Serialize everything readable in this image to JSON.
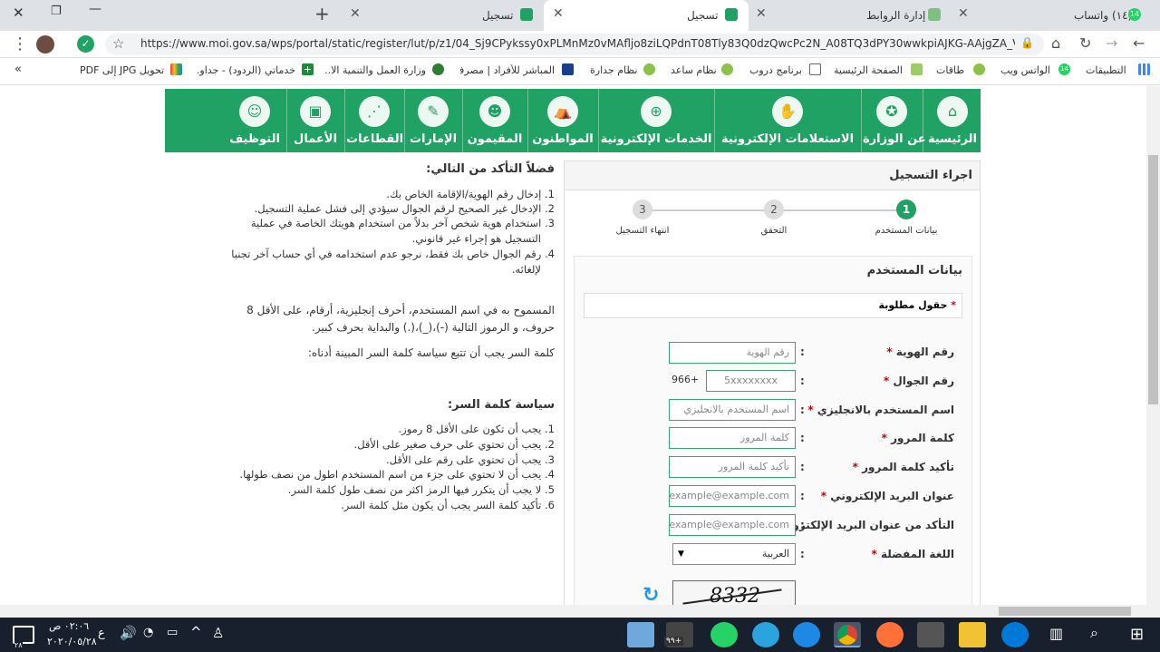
{
  "tabs": [
    {
      "title": "(١٤) واتساب",
      "badge": "14"
    },
    {
      "title": "إدارة الروابط"
    },
    {
      "title": "تسجيل",
      "active": true
    },
    {
      "title": "تسجيل"
    }
  ],
  "window_controls": {
    "close": "✕",
    "maximize": "❐",
    "minimize": "—",
    "new_tab": "+"
  },
  "address": {
    "url": "https://www.moi.gov.sa/wps/portal/static/register/lut/p/z1/04_Sj9CPykssy0xPLMnMz0vMAfljo8ziLQPdnT08Tly83Q0dzQwcPc2N_A08TQ3dPY30wwkpiAJKG-AAjgZA_V..."
  },
  "bookmarks": [
    {
      "label": "التطبيقات"
    },
    {
      "label": "الواتس ويب",
      "badge": "14"
    },
    {
      "label": "طاقات"
    },
    {
      "label": "الصفحة الرئيسية"
    },
    {
      "label": "برنامج دروب"
    },
    {
      "label": "نظام ساعد"
    },
    {
      "label": "نظام جدارة"
    },
    {
      "label": "المباشر للأفراد | مصرف..."
    },
    {
      "label": "وزارة العمل والتنمية الا..."
    },
    {
      "label": "خدماتي (الردود) - جداو..."
    },
    {
      "label": "تحويل JPG إلى PDF"
    },
    {
      "label": "»"
    }
  ],
  "nav": [
    {
      "label": "الرئيسية",
      "icon": "home-icon"
    },
    {
      "label": "عن الوزارة",
      "icon": "emblem-icon"
    },
    {
      "label": "الاستعلامات الإلكترونية",
      "icon": "globe-hand-icon"
    },
    {
      "label": "الخدمات الإلكترونية",
      "icon": "globe-icon"
    },
    {
      "label": "المواطنون",
      "icon": "user-icon"
    },
    {
      "label": "المقيمون",
      "icon": "group-icon"
    },
    {
      "label": "الإمارات",
      "icon": "calligraphy-icon"
    },
    {
      "label": "القطاعات",
      "icon": "network-icon"
    },
    {
      "label": "الأعمال",
      "icon": "briefcase-icon"
    },
    {
      "label": "التوظيف",
      "icon": "people-icon"
    }
  ],
  "registration": {
    "header": "اجراء التسجيل",
    "steps": [
      {
        "num": "1",
        "label": "بيانات المستخدم"
      },
      {
        "num": "2",
        "label": "التحقق"
      },
      {
        "num": "3",
        "label": "انتهاء التسجيل"
      }
    ],
    "section_title": "بيانات المستخدم",
    "required_note": "حقول مطلوبة",
    "fields": [
      {
        "label": "رقم الهوية",
        "placeholder": "رقم الهوية"
      },
      {
        "label": "رقم الجوال",
        "placeholder": "5xxxxxxxx",
        "prefix": "966+"
      },
      {
        "label": "اسم المستخدم بالانجليزي",
        "placeholder": "اسم المستخدم بالانجليزي"
      },
      {
        "label": "كلمة المرور",
        "placeholder": "كلمة المرور"
      },
      {
        "label": "تأكيد كلمة المرور",
        "placeholder": "تأكيد كلمة المرور"
      },
      {
        "label": "عنوان البريد الإلكتروني",
        "placeholder": "example@example.com"
      },
      {
        "label": "التأكد من عنوان البريد الإلكتروني",
        "placeholder": "example@example.com"
      },
      {
        "label": "اللغة المفضلة",
        "value": "العربية"
      }
    ],
    "captcha": "8332"
  },
  "instructions": {
    "title": "فضلاً التأكد من التالي:",
    "items": [
      "1. إدخال رقم الهوية/الإقامة الخاص بك.",
      "2. الإدخال غير الصحيح لرقم الجوال سيؤدي إلى فشل عملية التسجيل.",
      "3. استخدام هوية شخص آخر بدلاً من استخدام هويتك الخاصة في عملية",
      "التسجيل هو إجراء غير قانوني.",
      "4. رقم الجوال خاص بك فقط، نرجو عدم استخدامه في أي حساب آخر تجنبا",
      "لإلغائه."
    ],
    "username_rule_1": "المسموح به في اسم المستخدم، أحرف إنجليزية، أرقام، على الأقل 8",
    "username_rule_2": "حروف، و الرموز التالية (-)،(_)،(.) والبداية بحرف كبير.",
    "password_note": "كلمة السر يجب أن تتبع سياسة كلمة السر المبينة أدناه:",
    "policy_title": "سياسة كلمة السر:",
    "policy": [
      "1. يجب أن تكون على الأقل 8 رموز.",
      "2. يجب أن تحتوي على حرف صغير على الأقل.",
      "3. يجب أن تحتوي على رقم على الأقل.",
      "4. يجب أن لا تحتوي على جزء من اسم المستخدم اطول من نصف طولها.",
      "5. لا يجب أن يتكرر فيها الرمز اكثر من نصف طول كلمة السر.",
      "6. تأكيد كلمة السر يجب أن يكون مثل كلمة السر."
    ]
  },
  "taskbar": {
    "time": "٠٢:٠٦ ص",
    "date": "٢٠٢٠/٠٥/٢٨",
    "lang": "ع",
    "mail_badge": "٩٩+",
    "notif": "٢٨"
  },
  "colors": {
    "brand_green": "#1fa263",
    "step_active": "#1fa263",
    "taskbar": "#17202c"
  }
}
